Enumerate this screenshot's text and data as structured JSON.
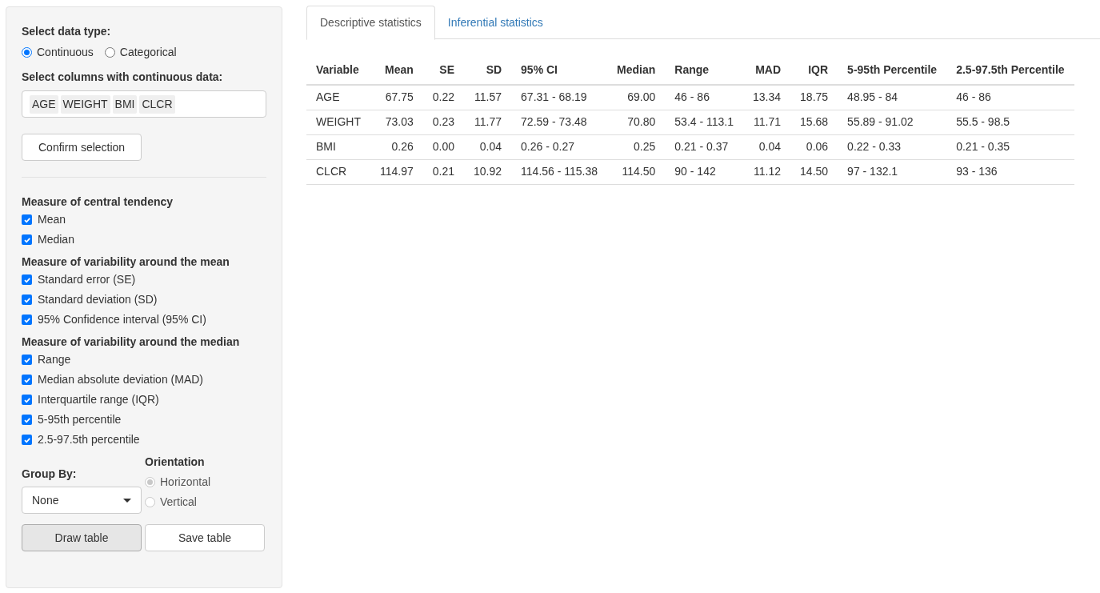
{
  "sidebar": {
    "data_type": {
      "label": "Select data type:",
      "options": [
        {
          "label": "Continuous",
          "selected": true
        },
        {
          "label": "Categorical",
          "selected": false
        }
      ]
    },
    "columns": {
      "label": "Select columns with continuous data:",
      "tags": [
        "AGE",
        "WEIGHT",
        "BMI",
        "CLCR"
      ]
    },
    "confirm_button": "Confirm selection",
    "groups": [
      {
        "title": "Measure of central tendency",
        "items": [
          {
            "label": "Mean",
            "checked": true
          },
          {
            "label": "Median",
            "checked": true
          }
        ]
      },
      {
        "title": "Measure of variability around the mean",
        "items": [
          {
            "label": "Standard error (SE)",
            "checked": true
          },
          {
            "label": "Standard deviation (SD)",
            "checked": true
          },
          {
            "label": "95% Confidence interval (95% CI)",
            "checked": true
          }
        ]
      },
      {
        "title": "Measure of variability around the median",
        "items": [
          {
            "label": "Range",
            "checked": true
          },
          {
            "label": "Median absolute deviation (MAD)",
            "checked": true
          },
          {
            "label": "Interquartile range (IQR)",
            "checked": true
          },
          {
            "label": "5-95th percentile",
            "checked": true
          },
          {
            "label": "2.5-97.5th percentile",
            "checked": true
          }
        ]
      }
    ],
    "group_by": {
      "label": "Group By:",
      "value": "None"
    },
    "orientation": {
      "label": "Orientation",
      "options": [
        {
          "label": "Horizontal",
          "selected": true,
          "disabled": true
        },
        {
          "label": "Vertical",
          "selected": false,
          "disabled": true
        }
      ]
    },
    "buttons": [
      {
        "label": "Draw table",
        "pressed": true
      },
      {
        "label": "Save table",
        "pressed": false
      }
    ]
  },
  "tabs": [
    {
      "label": "Descriptive statistics",
      "selected": true
    },
    {
      "label": "Inferential statistics",
      "selected": false
    }
  ],
  "table": {
    "columns": [
      {
        "label": "Variable",
        "kind": "text"
      },
      {
        "label": "Mean",
        "kind": "number"
      },
      {
        "label": "SE",
        "kind": "number"
      },
      {
        "label": "SD",
        "kind": "number"
      },
      {
        "label": "95% CI",
        "kind": "text"
      },
      {
        "label": "Median",
        "kind": "number"
      },
      {
        "label": "Range",
        "kind": "text"
      },
      {
        "label": "MAD",
        "kind": "number"
      },
      {
        "label": "IQR",
        "kind": "number"
      },
      {
        "label": "5-95th Percentile",
        "kind": "text"
      },
      {
        "label": "2.5-97.5th Percentile",
        "kind": "text"
      }
    ],
    "rows": [
      [
        "AGE",
        "67.75",
        "0.22",
        "11.57",
        "67.31 - 68.19",
        "69.00",
        "46 - 86",
        "13.34",
        "18.75",
        "48.95 - 84",
        "46 - 86"
      ],
      [
        "WEIGHT",
        "73.03",
        "0.23",
        "11.77",
        "72.59 - 73.48",
        "70.80",
        "53.4 - 113.1",
        "11.71",
        "15.68",
        "55.89 - 91.02",
        "55.5 - 98.5"
      ],
      [
        "BMI",
        "0.26",
        "0.00",
        "0.04",
        "0.26 - 0.27",
        "0.25",
        "0.21 - 0.37",
        "0.04",
        "0.06",
        "0.22 - 0.33",
        "0.21 - 0.35"
      ],
      [
        "CLCR",
        "114.97",
        "0.21",
        "10.92",
        "114.56 - 115.38",
        "114.50",
        "90 - 142",
        "11.12",
        "14.50",
        "97 - 132.1",
        "93 - 136"
      ]
    ]
  }
}
